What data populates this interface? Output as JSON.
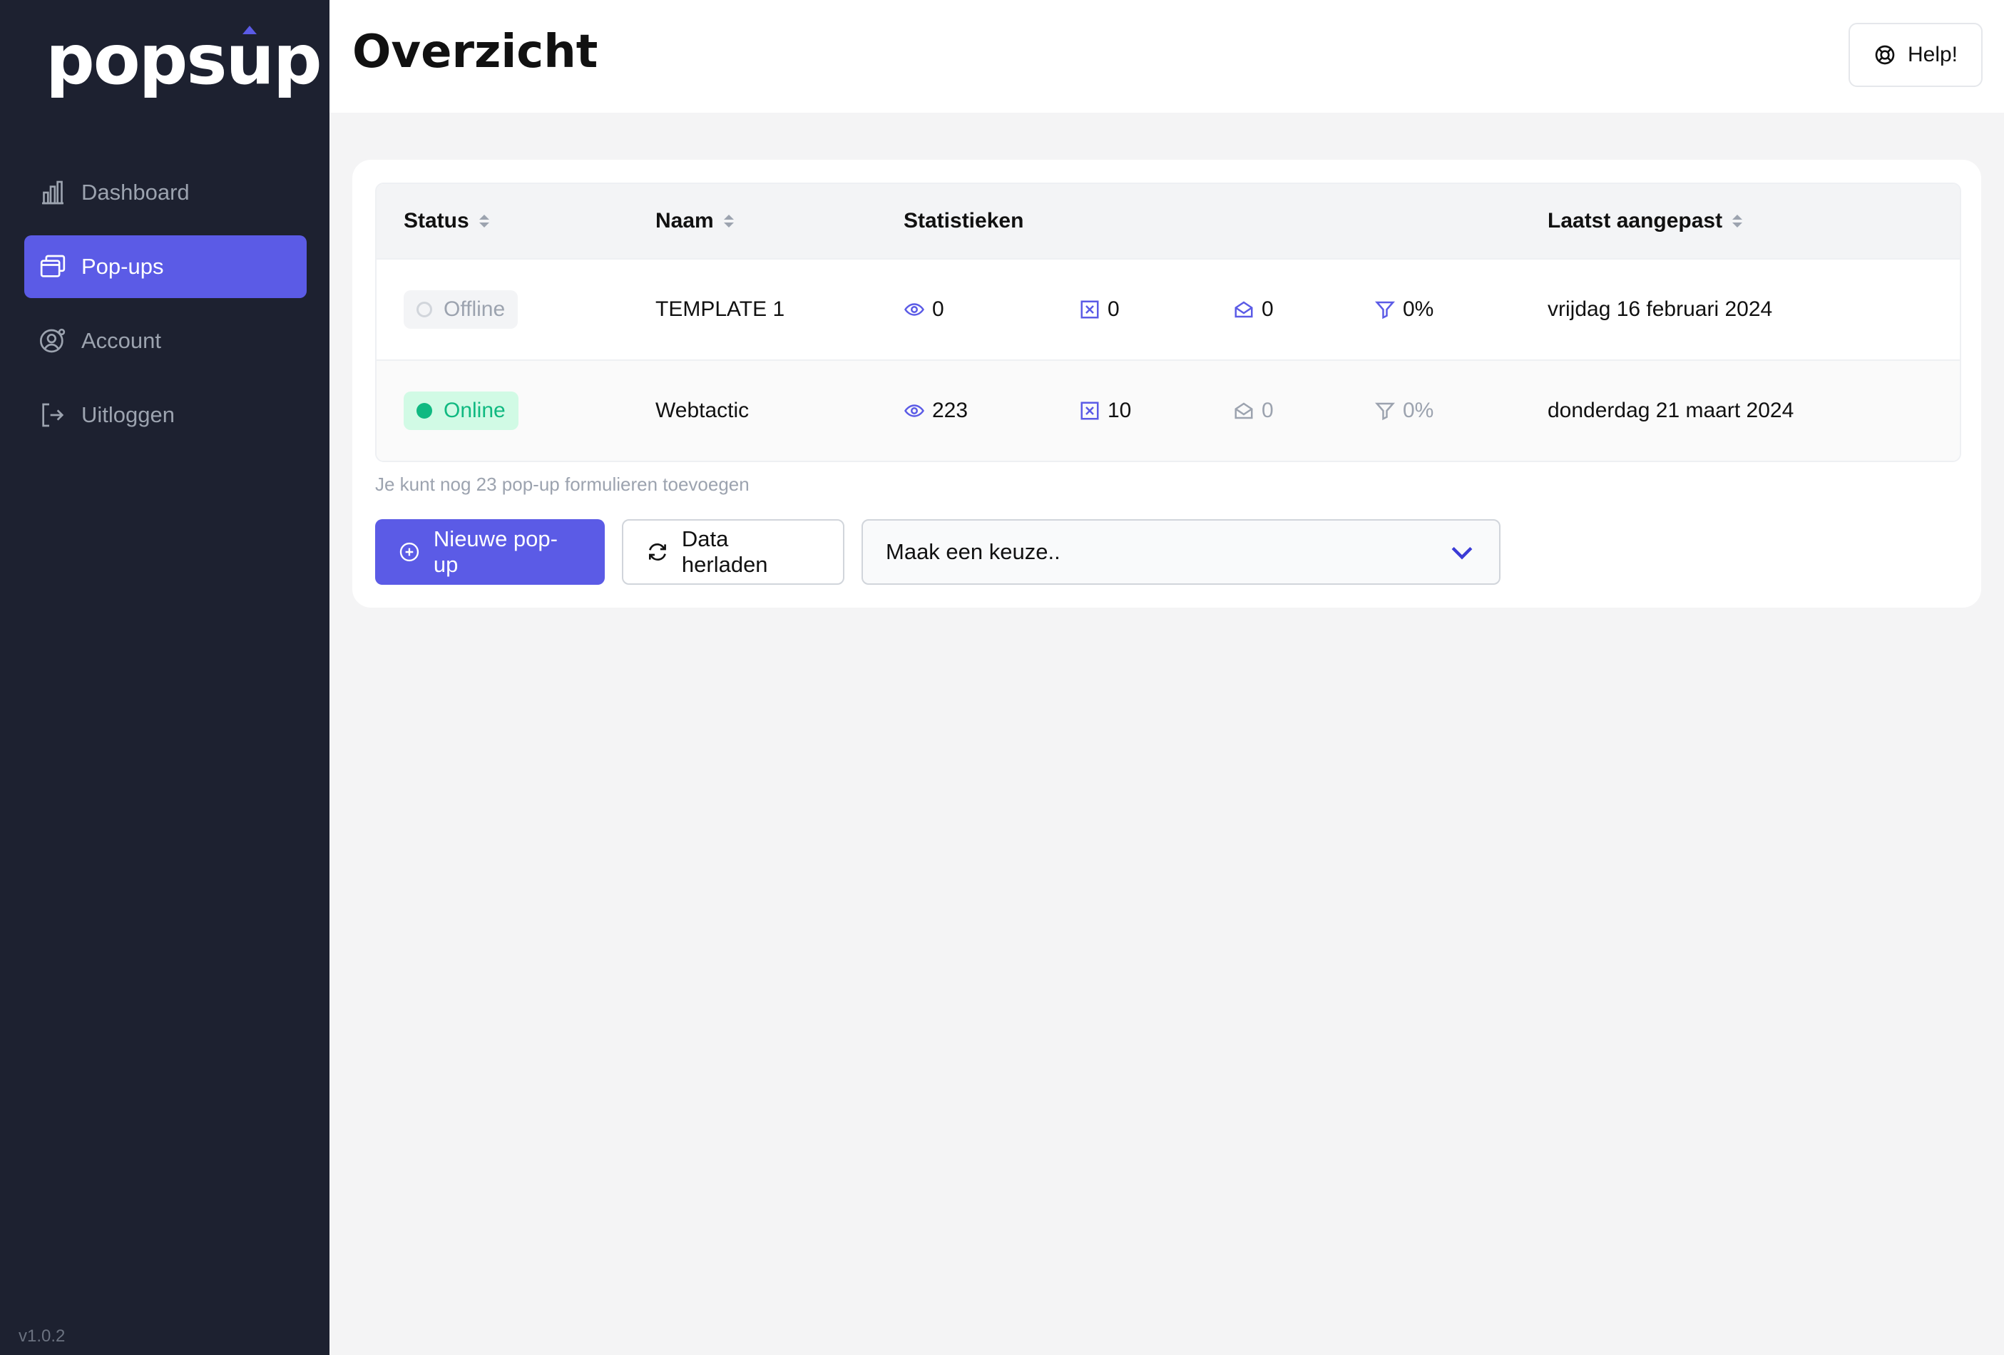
{
  "app": {
    "logo_text": "popsup",
    "version": "v1.0.2"
  },
  "sidebar": {
    "items": [
      {
        "label": "Dashboard",
        "icon": "bar-chart-icon",
        "active": false
      },
      {
        "label": "Pop-ups",
        "icon": "windows-icon",
        "active": true
      },
      {
        "label": "Account",
        "icon": "user-gear-icon",
        "active": false
      },
      {
        "label": "Uitloggen",
        "icon": "logout-icon",
        "active": false
      }
    ]
  },
  "header": {
    "title": "Overzicht",
    "help_label": "Help!"
  },
  "table": {
    "columns": [
      "Status",
      "Naam",
      "Statistieken",
      "Laatst aangepast"
    ],
    "rows": [
      {
        "status": "Offline",
        "name": "TEMPLATE 1",
        "views": "0",
        "closes": "0",
        "submissions": "0",
        "conversion": "0%",
        "modified": "vrijdag 16 februari 2024"
      },
      {
        "status": "Online",
        "name": "Webtactic",
        "views": "223",
        "closes": "10",
        "submissions": "0",
        "conversion": "0%",
        "modified": "donderdag 21 maart 2024"
      }
    ]
  },
  "footer": {
    "hint": "Je kunt nog 23 pop-up formulieren toevoegen",
    "new_button": "Nieuwe pop-up",
    "reload_button": "Data herladen",
    "select_placeholder": "Maak een keuze.."
  },
  "colors": {
    "accent": "#5b5be6",
    "sidebar": "#1d2130",
    "online": "#10b981"
  }
}
